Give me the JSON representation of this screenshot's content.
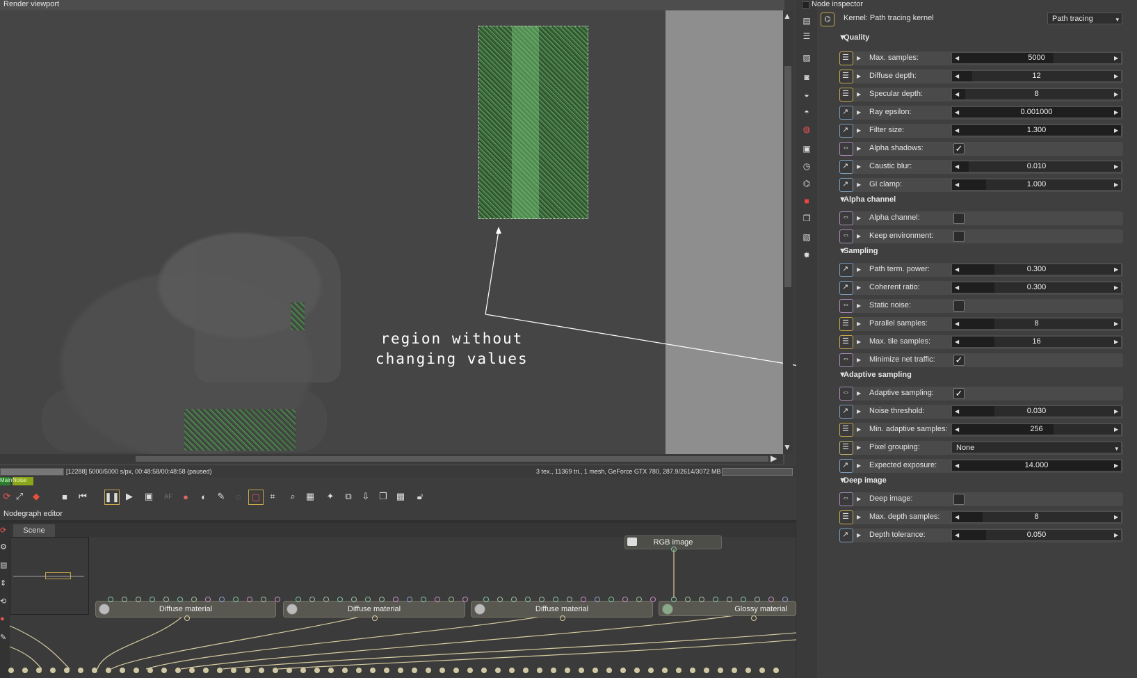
{
  "viewport": {
    "title": "Render viewport",
    "annotation_line1": "region without",
    "annotation_line2": "changing values",
    "status_left": "[12288] 5000/5000 s/px, 00:48:58/00:48:58 (paused)",
    "status_right": "3 tex., 11369 tri., 1 mesh, GeForce GTX 780, 287.9/2614/3072 MB",
    "tag_main": "Main",
    "tag_noise": "Noise"
  },
  "nodegraph": {
    "title": "Nodegraph editor",
    "tab": "Scene",
    "rgb_node": "RGB image",
    "nodes": [
      "Diffuse material",
      "Diffuse material",
      "Diffuse material",
      "Glossy material"
    ]
  },
  "inspector": {
    "title": "Node inspector",
    "kernel_label": "Kernel: Path tracing kernel",
    "kernel_value": "Path tracing",
    "sections": {
      "quality": "Quality",
      "alpha": "Alpha channel",
      "sampling": "Sampling",
      "adaptive": "Adaptive sampling",
      "deep": "Deep image"
    },
    "params": {
      "max_samples": {
        "label": "Max. samples:",
        "value": "5000",
        "fill": 0.6
      },
      "diffuse_depth": {
        "label": "Diffuse depth:",
        "value": "12",
        "fill": 0.12
      },
      "specular_depth": {
        "label": "Specular depth:",
        "value": "8",
        "fill": 0.08
      },
      "ray_epsilon": {
        "label": "Ray epsilon:",
        "value": "0.001000",
        "fill": 1.0
      },
      "filter_size": {
        "label": "Filter size:",
        "value": "1.300",
        "fill": 1.0
      },
      "alpha_shadows": {
        "label": "Alpha shadows:",
        "checked": true
      },
      "caustic_blur": {
        "label": "Caustic blur:",
        "value": "0.010",
        "fill": 0.1
      },
      "gi_clamp": {
        "label": "GI clamp:",
        "value": "1.000",
        "fill": 0.2
      },
      "alpha_channel": {
        "label": "Alpha channel:",
        "checked": false
      },
      "keep_environment": {
        "label": "Keep environment:",
        "checked": false
      },
      "path_term_power": {
        "label": "Path term. power:",
        "value": "0.300",
        "fill": 0.25
      },
      "coherent_ratio": {
        "label": "Coherent ratio:",
        "value": "0.300",
        "fill": 0.25
      },
      "static_noise": {
        "label": "Static noise:",
        "checked": false
      },
      "parallel_samples": {
        "label": "Parallel samples:",
        "value": "8",
        "fill": 0.25
      },
      "max_tile_samples": {
        "label": "Max. tile samples:",
        "value": "16",
        "fill": 0.25
      },
      "minimize_net_traffic": {
        "label": "Minimize net traffic:",
        "checked": true
      },
      "adaptive_sampling": {
        "label": "Adaptive sampling:",
        "checked": true
      },
      "noise_threshold": {
        "label": "Noise threshold:",
        "value": "0.030",
        "fill": 0.25
      },
      "min_adaptive_samples": {
        "label": "Min. adaptive samples:",
        "value": "256",
        "fill": 0.6
      },
      "pixel_grouping": {
        "label": "Pixel grouping:",
        "value": "None"
      },
      "expected_exposure": {
        "label": "Expected exposure:",
        "value": "14.000",
        "fill": 1.0
      },
      "deep_image": {
        "label": "Deep image:",
        "checked": false
      },
      "max_depth_samples": {
        "label": "Max. depth samples:",
        "value": "8",
        "fill": 0.18
      },
      "depth_tolerance": {
        "label": "Depth tolerance:",
        "value": "0.050",
        "fill": 0.2
      }
    }
  },
  "icons": {
    "toolbar": [
      "refresh-icon",
      "fit-icon",
      "cube-icon",
      "stop-icon",
      "rewind-icon",
      "pause-icon",
      "play-icon",
      "monitor-icon",
      "af-icon",
      "color-icon",
      "sphere-icon",
      "pen-icon",
      "dof-icon",
      "region-icon",
      "crop-icon",
      "zoom-icon",
      "film-icon",
      "picker-icon",
      "copy-icon",
      "export-icon",
      "layers-icon",
      "screenshot-icon",
      "lock-icon"
    ]
  }
}
